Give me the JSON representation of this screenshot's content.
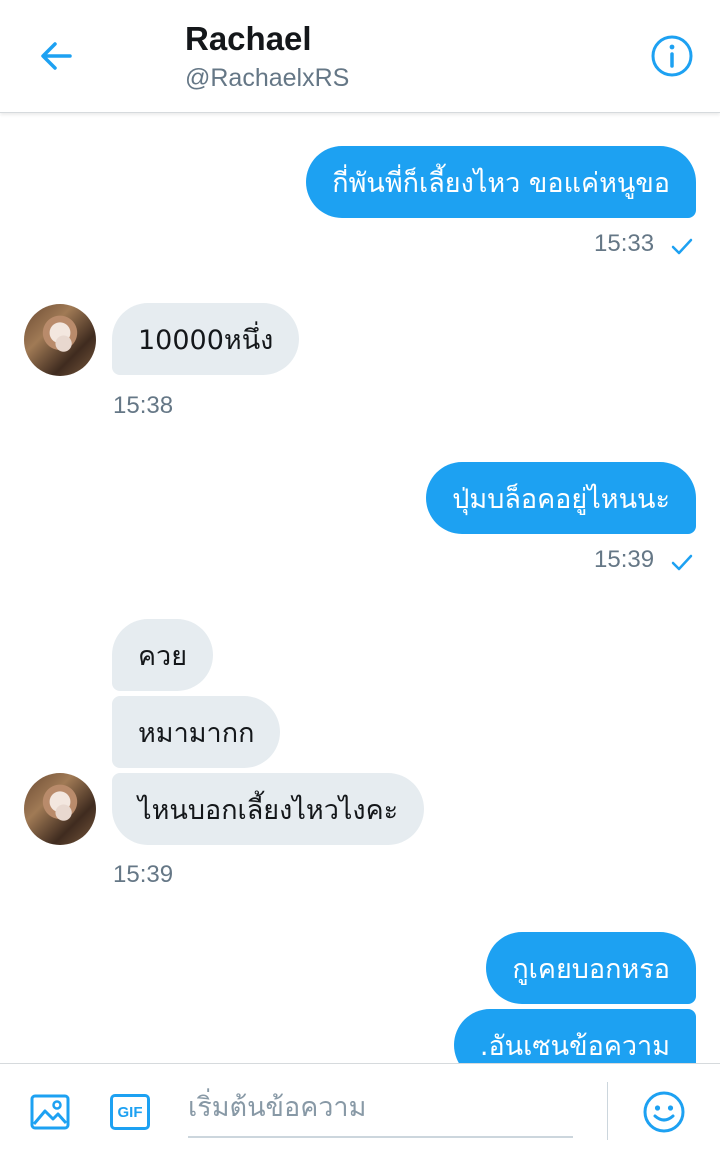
{
  "header": {
    "title": "Rachael",
    "handle": "@RachaelxRS"
  },
  "messages": [
    {
      "direction": "sent",
      "text": "กี่พันพี่ก็เลี้ยงไหว ขอแค่หนูขอ"
    },
    {
      "direction": "sent_time",
      "text": "15:33"
    },
    {
      "direction": "received",
      "text": "10000หนึ่ง"
    },
    {
      "direction": "received_time",
      "text": "15:38"
    },
    {
      "direction": "sent",
      "text": "ปุ่มบล็อคอยู่ไหนนะ"
    },
    {
      "direction": "sent_time",
      "text": "15:39"
    },
    {
      "direction": "received",
      "text": "ควย"
    },
    {
      "direction": "received",
      "text": "หมามากก"
    },
    {
      "direction": "received",
      "text": "ไหนบอกเลี้ยงไหวไงคะ"
    },
    {
      "direction": "received_time",
      "text": "15:39"
    },
    {
      "direction": "sent",
      "text": "กูเคยบอกหรอ"
    },
    {
      "direction": "sent",
      "text": ".อันเซนข้อความ"
    }
  ],
  "composer": {
    "placeholder": "เริ่มต้นข้อความ",
    "value": ""
  },
  "icons": {
    "back": "arrow-left-icon",
    "info": "info-icon",
    "media": "image-icon",
    "gif": "gif-icon",
    "emoji": "emoji-icon",
    "read": "checkmark-icon",
    "gif_label": "GIF"
  },
  "colors": {
    "accent": "#1da1f2",
    "received_bubble": "#e6ecf0",
    "muted_text": "#657786"
  }
}
